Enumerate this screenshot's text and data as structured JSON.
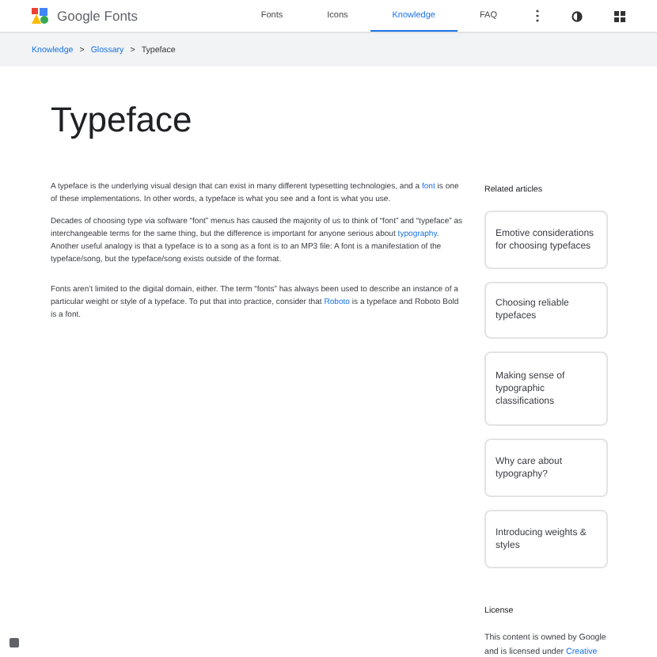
{
  "header": {
    "brand": "Google Fonts",
    "nav": [
      {
        "label": "Fonts",
        "selected": false
      },
      {
        "label": "Icons",
        "selected": false
      },
      {
        "label": "Knowledge",
        "selected": true
      },
      {
        "label": "FAQ",
        "selected": false
      }
    ]
  },
  "breadcrumb": [
    {
      "label": "Knowledge",
      "kind": "link"
    },
    {
      "label": ">",
      "kind": "sep"
    },
    {
      "label": "Glossary",
      "kind": "link"
    },
    {
      "label": ">",
      "kind": "sep"
    },
    {
      "label": "Typeface",
      "kind": "current"
    }
  ],
  "title": "Typeface",
  "paragraphs": [
    [
      {
        "kind": "text",
        "text": "A typeface is the underlying visual design that can exist in many different typesetting technologies, and a "
      },
      {
        "kind": "link",
        "text": "font"
      },
      {
        "kind": "text",
        "text": " is one of these implementations. In other words, a typeface is what you see and a font is what you use."
      }
    ],
    [
      {
        "kind": "text",
        "text": "Decades of choosing type via software “font” menus has caused the majority of us to think of “font” and “typeface” as interchangeable terms for the same thing, but the difference is important for anyone serious about "
      },
      {
        "kind": "link",
        "text": "typography"
      },
      {
        "kind": "text",
        "text": ". Another useful analogy is that a typeface is to a song as a font is to an MP3 file: A font is a manifestation of the typeface/song, but the typeface/song exists outside of the format."
      }
    ],
    [
      {
        "kind": "text",
        "text": "Fonts aren’t limited to the digital domain, either. The term “fonts” has always been used to describe an instance of a particular weight or style of a typeface. To put that into practice, consider that "
      },
      {
        "kind": "link",
        "text": "Roboto"
      },
      {
        "kind": "text",
        "text": " is a typeface and Roboto Bold is a font."
      }
    ]
  ],
  "related": {
    "heading": "Related articles",
    "articles": [
      "Emotive considerations for choosing typefaces",
      "Choosing reliable typefaces",
      "Making sense of typographic classifications",
      "Why care about typography?",
      "Introducing weights & styles"
    ]
  },
  "license": {
    "heading": "License",
    "text": "This content is owned by Google and is licensed under ",
    "link": "Creative"
  }
}
